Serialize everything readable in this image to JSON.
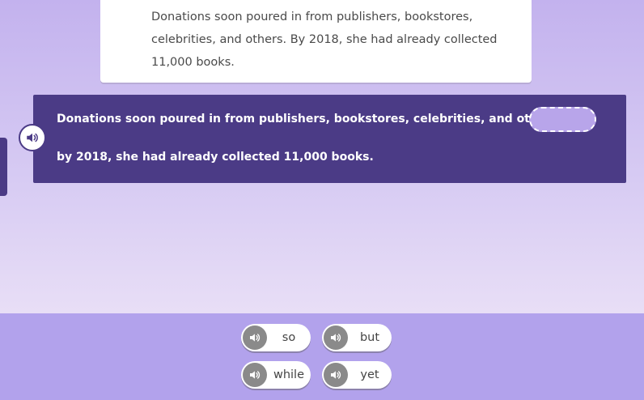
{
  "passage": {
    "lines": [
      "Donations soon poured in from publishers, bookstores,",
      "celebrities, and others. By 2018, she had already collected",
      "11,000 books."
    ]
  },
  "question": {
    "line1": "Donations soon poured in from publishers, bookstores, celebrities, and others,",
    "line2": "by 2018, she had already collected 11,000 books.",
    "audio_icon": "speaker-icon"
  },
  "choices": [
    {
      "word": "so",
      "icon": "speaker-icon"
    },
    {
      "word": "but",
      "icon": "speaker-icon"
    },
    {
      "word": "while",
      "icon": "speaker-icon"
    },
    {
      "word": "yet",
      "icon": "speaker-icon"
    }
  ],
  "colors": {
    "question_bg": "#4b3b86",
    "blank_fill": "#b8a5ea",
    "tray_bg": "#b2a2ec",
    "speaker_gray": "#8a8a8a"
  }
}
